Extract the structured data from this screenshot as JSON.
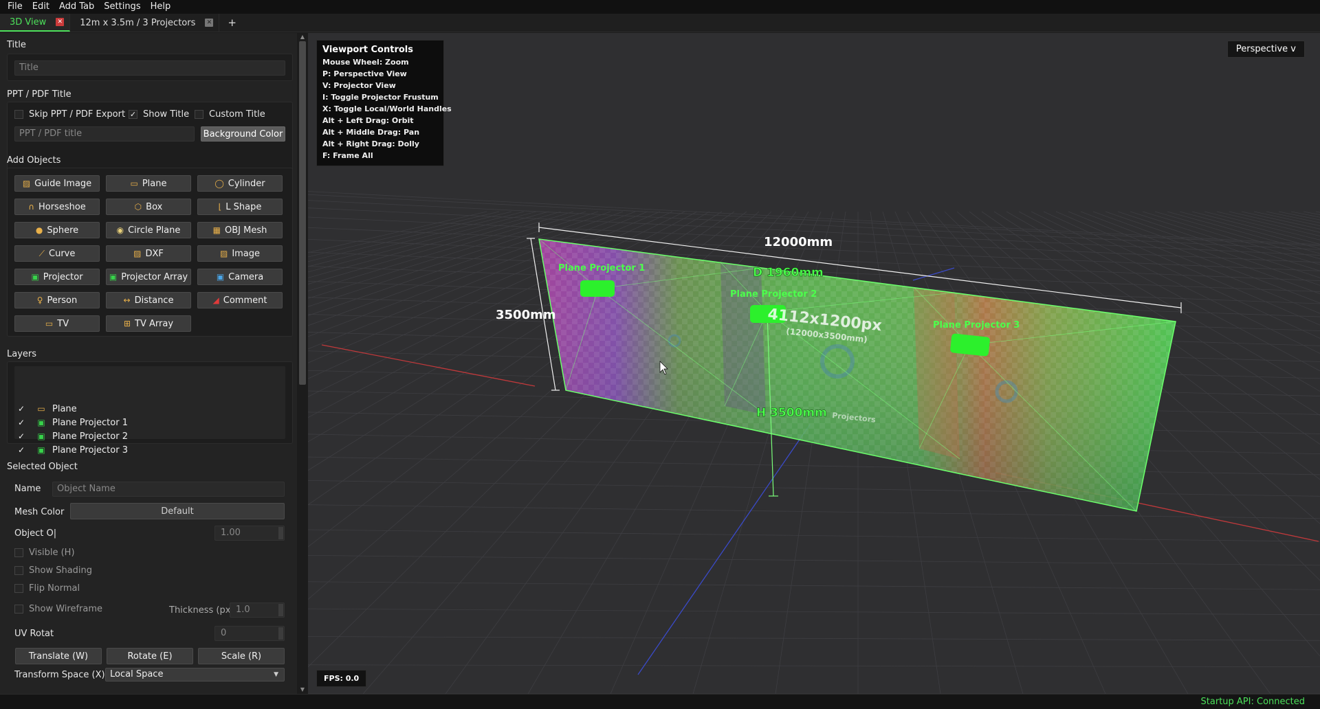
{
  "menu": [
    "File",
    "Edit",
    "Add Tab",
    "Settings",
    "Help"
  ],
  "tabs": [
    {
      "label": "3D View",
      "active": true
    },
    {
      "label": "12m x 3.5m / 3 Projectors",
      "active": false
    }
  ],
  "tab_add": "+",
  "title_section": {
    "label": "Title",
    "placeholder": "Title"
  },
  "ppt_section": {
    "label": "PPT / PDF Title",
    "skip_export": "Skip PPT / PDF Export",
    "show_title": "Show Title",
    "custom_title": "Custom Title",
    "placeholder": "PPT / PDF title",
    "bg_color": "Background Color"
  },
  "add_objects": {
    "label": "Add Objects",
    "buttons": [
      {
        "label": "Guide Image",
        "icon": "image-icon",
        "glyph": "▨",
        "color": "#e8b04a"
      },
      {
        "label": "Plane",
        "icon": "plane-icon",
        "glyph": "▭",
        "color": "#e8b04a"
      },
      {
        "label": "Cylinder",
        "icon": "cylinder-icon",
        "glyph": "◯",
        "color": "#e8b04a"
      },
      {
        "label": "Horseshoe",
        "icon": "horseshoe-icon",
        "glyph": "∩",
        "color": "#e8b04a"
      },
      {
        "label": "Box",
        "icon": "box-icon",
        "glyph": "⬡",
        "color": "#e8b04a"
      },
      {
        "label": "L Shape",
        "icon": "l-shape-icon",
        "glyph": "⌊",
        "color": "#e8b04a"
      },
      {
        "label": "Sphere",
        "icon": "sphere-icon",
        "glyph": "●",
        "color": "#e8b04a"
      },
      {
        "label": "Circle Plane",
        "icon": "circle-plane-icon",
        "glyph": "◉",
        "color": "#e8d07a"
      },
      {
        "label": "OBJ Mesh",
        "icon": "mesh-icon",
        "glyph": "▦",
        "color": "#e8b04a"
      },
      {
        "label": "Curve",
        "icon": "curve-icon",
        "glyph": "⟋",
        "color": "#e8b04a"
      },
      {
        "label": "DXF",
        "icon": "dxf-icon",
        "glyph": "▨",
        "color": "#e8b04a"
      },
      {
        "label": "Image",
        "icon": "image-icon",
        "glyph": "▨",
        "color": "#e8b04a"
      },
      {
        "label": "Projector",
        "icon": "projector-icon",
        "glyph": "▣",
        "color": "#37d24a"
      },
      {
        "label": "Projector Array",
        "icon": "projector-array-icon",
        "glyph": "▣",
        "color": "#37d24a"
      },
      {
        "label": "Camera",
        "icon": "camera-icon",
        "glyph": "▣",
        "color": "#4aa6e8"
      },
      {
        "label": "Person",
        "icon": "person-icon",
        "glyph": "♀",
        "color": "#e8b04a"
      },
      {
        "label": "Distance",
        "icon": "distance-icon",
        "glyph": "↔",
        "color": "#e8b04a"
      },
      {
        "label": "Comment",
        "icon": "comment-icon",
        "glyph": "◢",
        "color": "#e03a3a"
      },
      {
        "label": "TV",
        "icon": "tv-icon",
        "glyph": "▭",
        "color": "#e8b04a"
      },
      {
        "label": "TV Array",
        "icon": "tv-array-icon",
        "glyph": "⊞",
        "color": "#e8b04a"
      }
    ]
  },
  "layers": {
    "label": "Layers",
    "items": [
      {
        "label": "Plane",
        "icon": "plane-icon",
        "glyph": "▭",
        "color": "#e8b04a"
      },
      {
        "label": "Plane Projector 1",
        "icon": "projector-icon",
        "glyph": "▣",
        "color": "#37d24a"
      },
      {
        "label": "Plane Projector 2",
        "icon": "projector-icon",
        "glyph": "▣",
        "color": "#37d24a"
      },
      {
        "label": "Plane Projector 3",
        "icon": "projector-icon",
        "glyph": "▣",
        "color": "#37d24a"
      }
    ]
  },
  "selected": {
    "label": "Selected Object",
    "name_label": "Name",
    "name_placeholder": "Object Name",
    "mesh_color_label": "Mesh Color",
    "mesh_color_value": "Default",
    "opacity_label": "Object O|",
    "opacity_value": "1.00",
    "visible": "Visible (H)",
    "show_shading": "Show Shading",
    "flip_normal": "Flip Normal",
    "show_wireframe": "Show Wireframe",
    "thickness_label": "Thickness (px)",
    "thickness_value": "1.0",
    "uv_label": "UV Rotat",
    "uv_value": "0",
    "translate": "Translate (W)",
    "rotate": "Rotate (E)",
    "scale": "Scale (R)",
    "transform_label": "Transform Space (X)",
    "transform_value": "Local Space"
  },
  "viewport": {
    "controls_title": "Viewport Controls",
    "controls": [
      "Mouse Wheel: Zoom",
      "P: Perspective View",
      "V: Projector View",
      "I: Toggle Projector Frustum",
      "X: Toggle Local/World Handles",
      "Alt + Left Drag: Orbit",
      "Alt + Middle Drag: Pan",
      "Alt + Right Drag: Dolly",
      "F: Frame All"
    ],
    "perspective": "Perspective v",
    "fps": "FPS: 0.0",
    "width_dim": "12000mm",
    "height_dim": "3500mm",
    "distance_dim": "D 1960mm",
    "h_dim": "H 3500mm",
    "resolution": "4112x1200px",
    "size_mm": "(12000x3500mm)",
    "projectors_text": "Projectors",
    "projector_labels": [
      "Plane Projector 1",
      "Plane Projector 2",
      "Plane Projector 3"
    ]
  },
  "status": "Startup API: Connected"
}
